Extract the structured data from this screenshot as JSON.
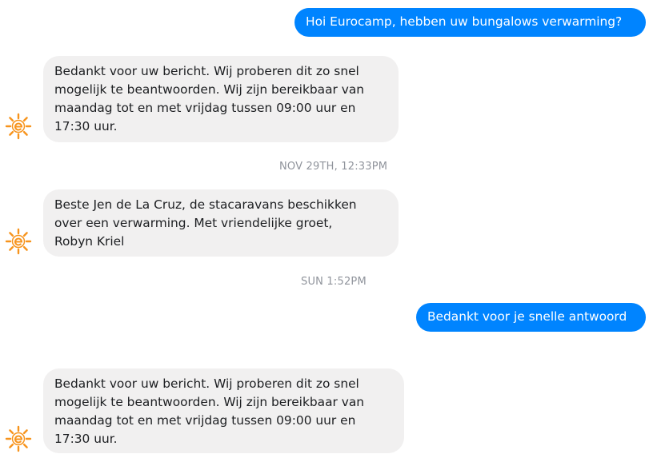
{
  "colors": {
    "outgoing_bubble": "#0084ff",
    "incoming_bubble": "#f1f0f0",
    "timestamp_text": "#90949c",
    "avatar_accent": "#f7941d"
  },
  "conversation": {
    "messages": [
      {
        "direction": "outgoing",
        "text": "Hoi Eurocamp, hebben uw bungalows verwarming?"
      },
      {
        "direction": "incoming",
        "avatar_icon": "eurocamp-sun-logo-icon",
        "text": "Bedankt voor uw bericht. Wij proberen dit zo snel\nmogelijk te beantwoorden. Wij zijn bereikbaar van\nmaandag tot en met vrijdag tussen 09:00 uur en\n17:30 uur."
      },
      {
        "direction": "incoming",
        "avatar_icon": "eurocamp-sun-logo-icon",
        "text": "Beste Jen de La Cruz, de stacaravans beschikken\nover een verwarming. Met vriendelijke groet,\nRobyn Kriel"
      },
      {
        "direction": "outgoing",
        "text": "Bedankt voor je snelle antwoord"
      },
      {
        "direction": "incoming",
        "avatar_icon": "eurocamp-sun-logo-icon",
        "text": "Bedankt voor uw bericht. Wij proberen dit zo snel\nmogelijk te beantwoorden. Wij zijn bereikbaar van\nmaandag tot en met vrijdag tussen 09:00 uur en\n17:30 uur."
      }
    ],
    "timestamps": [
      "NOV 29TH, 12:33PM",
      "SUN 1:52PM"
    ]
  }
}
